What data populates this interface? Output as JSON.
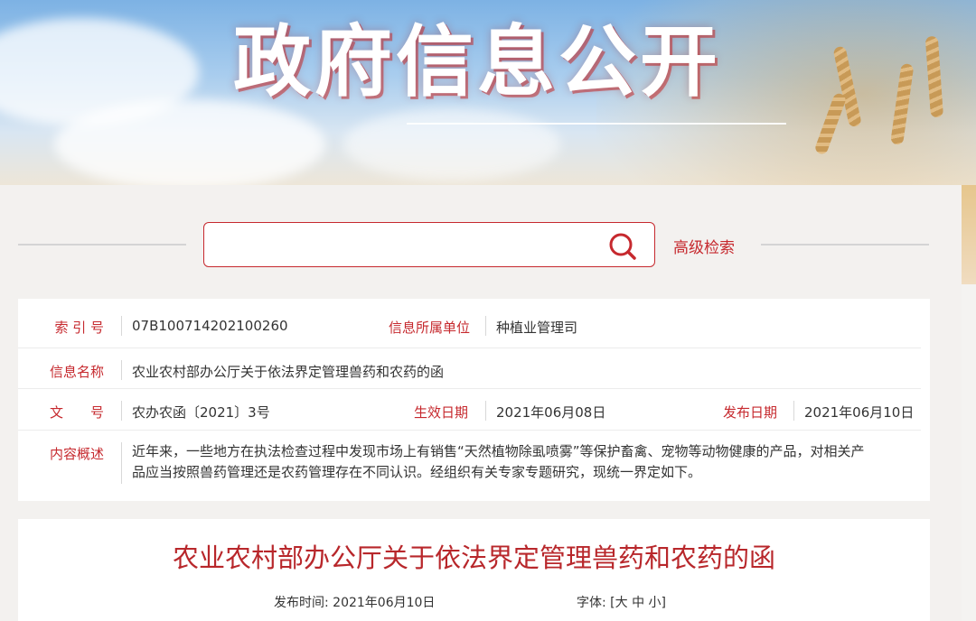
{
  "banner": {
    "title": "政府信息公开"
  },
  "search": {
    "placeholder": "",
    "advanced_label": "高级检索"
  },
  "meta": {
    "index_label": "索 引 号",
    "index_value": "07B100714202100260",
    "unit_label": "信息所属单位",
    "unit_value": "种植业管理司",
    "name_label": "信息名称",
    "name_value": "农业农村部办公厅关于依法界定管理兽药和农药的函",
    "doc_label": "文　　号",
    "doc_value": "农办农函〔2021〕3号",
    "effective_label": "生效日期",
    "effective_value": "2021年06月08日",
    "publish_label": "发布日期",
    "publish_value": "2021年06月10日",
    "summary_label": "内容概述",
    "summary_line1": "近年来，一些地方在执法检查过程中发现市场上有销售“天然植物除虱喷雾”等保护畜禽、宠物等动物健康的产品，对相关产",
    "summary_line2": "品应当按照兽药管理还是农药管理存在不同认识。经组织有关专家专题研究，现统一界定如下。"
  },
  "article": {
    "title": "农业农村部办公厅关于依法界定管理兽药和农药的函",
    "pub_time_label": "发布时间:",
    "pub_time_value": "2021年06月10日",
    "font_label": "字体:",
    "font_open": "[",
    "font_large": "大",
    "font_medium": "中",
    "font_small": "小",
    "font_close": "]"
  },
  "colors": {
    "accent": "#c6292e",
    "title_red": "#b8272b"
  }
}
